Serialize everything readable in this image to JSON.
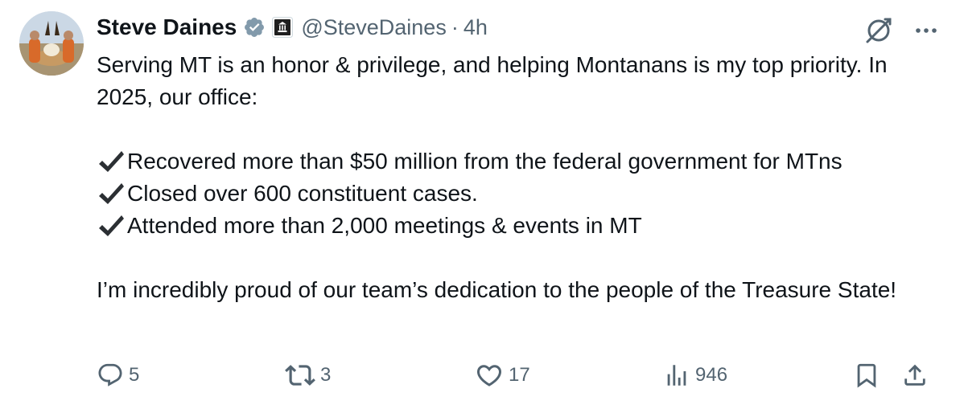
{
  "post": {
    "author": {
      "name": "Steve Daines",
      "handle": "@SteveDaines",
      "separator": "·",
      "time": "4h"
    },
    "text": {
      "intro": "Serving MT is an honor & privilege, and helping Montanans is my top priority. In 2025, our office:",
      "bullets": [
        "Recovered more than $50 million from the federal government for MTns",
        "Closed over 600 constituent cases.",
        "Attended more than 2,000 meetings & events in MT"
      ],
      "closing": "I’m incredibly proud of our team’s dedication to the people of the Treasure State!"
    },
    "icons": {
      "verified": "verified-badge-icon",
      "affiliation": "government-building-icon",
      "grok": "grok-icon",
      "more": "more-icon",
      "bullet": "check-mark-icon"
    },
    "actions": {
      "replies": "5",
      "reposts": "3",
      "likes": "17",
      "views": "946"
    },
    "colors": {
      "text": "#0f1419",
      "secondary": "#536471",
      "verified_badge": "#829aab"
    }
  }
}
